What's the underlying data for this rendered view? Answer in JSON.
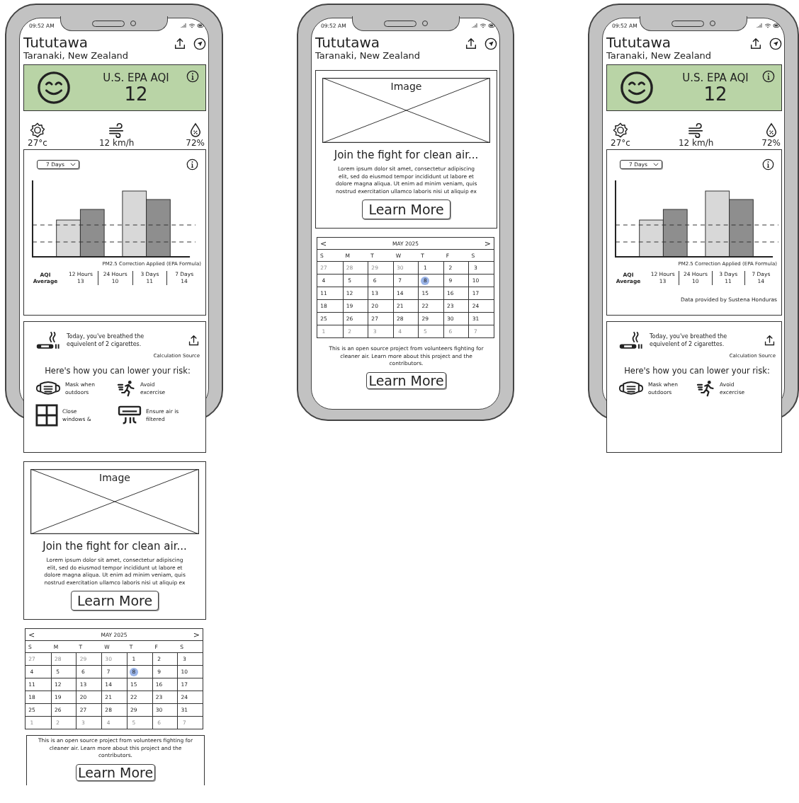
{
  "mockups": [
    {
      "status_time": "09:52 AM",
      "title": "Tututawa",
      "subtitle": "Taranaki, New Zealand",
      "sections": [
        {
          "kind": "aqi",
          "label": "U.S. EPA AQI",
          "value": "12"
        },
        {
          "kind": "weather",
          "items": [
            {
              "kind": "temperature",
              "text": "27°c"
            },
            {
              "kind": "wind",
              "text": "12 km/h"
            },
            {
              "kind": "humidity",
              "text": "72%"
            }
          ]
        },
        {
          "kind": "chart",
          "dropdown": "7 Days",
          "note": "PM2.5 Correction Applied (EPA Formula)",
          "average_label": "AQI Average",
          "averages": [
            {
              "label": "12 Hours",
              "value": "13"
            },
            {
              "label": "24 Hours",
              "value": "10"
            },
            {
              "label": "3 Days",
              "value": "11"
            },
            {
              "label": "7 Days",
              "value": "14"
            }
          ]
        },
        {
          "kind": "exposure",
          "text": "Today, you've breathed the equivelent of 2 cigarettes.",
          "source": "Calculation Source",
          "heading": "Here's how you can lower your risk:",
          "tips": [
            {
              "kind": "mask",
              "text": "Mask when outdoors"
            },
            {
              "kind": "exercise",
              "text": "Avoid excercise"
            },
            {
              "kind": "window",
              "text": "Close windows &"
            },
            {
              "kind": "filter",
              "text": "Ensure air is filtered"
            }
          ]
        },
        {
          "kind": "promo",
          "image_label": "Image",
          "heading": "Join the fight for clean air...",
          "body": "Lorem ipsum dolor sit amet, consectetur adipiscing elit, sed do eiusmod tempor incididunt ut labore et dolore magna aliqua. Ut enim ad minim veniam, quis nostrud exercitation ullamco laboris nisi ut aliquip ex",
          "button": "Learn More"
        },
        {
          "kind": "calendar",
          "month": "MAY 2025",
          "prev": "<",
          "next": ">",
          "weekdays": [
            "S",
            "M",
            "T",
            "W",
            "T",
            "F",
            "S"
          ],
          "weeks": [
            [
              {
                "day": "27",
                "outside": true,
                "selected": false
              },
              {
                "day": "28",
                "outside": true,
                "selected": false
              },
              {
                "day": "29",
                "outside": true,
                "selected": false
              },
              {
                "day": "30",
                "outside": true,
                "selected": false
              },
              {
                "day": "1",
                "outside": false,
                "selected": false
              },
              {
                "day": "2",
                "outside": false,
                "selected": false
              },
              {
                "day": "3",
                "outside": false,
                "selected": false
              }
            ],
            [
              {
                "day": "4",
                "outside": false,
                "selected": false
              },
              {
                "day": "5",
                "outside": false,
                "selected": false
              },
              {
                "day": "6",
                "outside": false,
                "selected": false
              },
              {
                "day": "7",
                "outside": false,
                "selected": false
              },
              {
                "day": "8",
                "outside": false,
                "selected": true
              },
              {
                "day": "9",
                "outside": false,
                "selected": false
              },
              {
                "day": "10",
                "outside": false,
                "selected": false
              }
            ],
            [
              {
                "day": "11",
                "outside": false,
                "selected": false
              },
              {
                "day": "12",
                "outside": false,
                "selected": false
              },
              {
                "day": "13",
                "outside": false,
                "selected": false
              },
              {
                "day": "14",
                "outside": false,
                "selected": false
              },
              {
                "day": "15",
                "outside": false,
                "selected": false
              },
              {
                "day": "16",
                "outside": false,
                "selected": false
              },
              {
                "day": "17",
                "outside": false,
                "selected": false
              }
            ],
            [
              {
                "day": "18",
                "outside": false,
                "selected": false
              },
              {
                "day": "19",
                "outside": false,
                "selected": false
              },
              {
                "day": "20",
                "outside": false,
                "selected": false
              },
              {
                "day": "21",
                "outside": false,
                "selected": false
              },
              {
                "day": "22",
                "outside": false,
                "selected": false
              },
              {
                "day": "23",
                "outside": false,
                "selected": false
              },
              {
                "day": "24",
                "outside": false,
                "selected": false
              }
            ],
            [
              {
                "day": "25",
                "outside": false,
                "selected": false
              },
              {
                "day": "26",
                "outside": false,
                "selected": false
              },
              {
                "day": "27",
                "outside": false,
                "selected": false
              },
              {
                "day": "28",
                "outside": false,
                "selected": false
              },
              {
                "day": "29",
                "outside": false,
                "selected": false
              },
              {
                "day": "30",
                "outside": false,
                "selected": false
              },
              {
                "day": "31",
                "outside": false,
                "selected": false
              }
            ],
            [
              {
                "day": "1",
                "outside": true,
                "selected": false
              },
              {
                "day": "2",
                "outside": true,
                "selected": false
              },
              {
                "day": "3",
                "outside": true,
                "selected": false
              },
              {
                "day": "4",
                "outside": true,
                "selected": false
              },
              {
                "day": "5",
                "outside": true,
                "selected": false
              },
              {
                "day": "6",
                "outside": true,
                "selected": false
              },
              {
                "day": "7",
                "outside": true,
                "selected": false
              }
            ]
          ]
        },
        {
          "kind": "about",
          "framed": true,
          "text": "This is an open source project from volunteers fighting for cleaner air. Learn more about this project and the contributors.",
          "button": "Learn More"
        }
      ]
    },
    {
      "status_time": "09:52 AM",
      "title": "Tututawa",
      "subtitle": "Taranaki, New Zealand",
      "sections": [
        {
          "kind": "promo",
          "image_label": "Image",
          "heading": "Join the fight for clean air...",
          "body": "Lorem ipsum dolor sit amet, consectetur adipiscing elit, sed do eiusmod tempor incididunt ut labore et dolore magna aliqua. Ut enim ad minim veniam, quis nostrud exercitation ullamco laboris nisi ut aliquip ex",
          "button": "Learn More"
        },
        {
          "kind": "calendar",
          "month": "MAY 2025",
          "prev": "<",
          "next": ">",
          "weekdays": [
            "S",
            "M",
            "T",
            "W",
            "T",
            "F",
            "S"
          ],
          "weeks": [
            [
              {
                "day": "27",
                "outside": true,
                "selected": false
              },
              {
                "day": "28",
                "outside": true,
                "selected": false
              },
              {
                "day": "29",
                "outside": true,
                "selected": false
              },
              {
                "day": "30",
                "outside": true,
                "selected": false
              },
              {
                "day": "1",
                "outside": false,
                "selected": false
              },
              {
                "day": "2",
                "outside": false,
                "selected": false
              },
              {
                "day": "3",
                "outside": false,
                "selected": false
              }
            ],
            [
              {
                "day": "4",
                "outside": false,
                "selected": false
              },
              {
                "day": "5",
                "outside": false,
                "selected": false
              },
              {
                "day": "6",
                "outside": false,
                "selected": false
              },
              {
                "day": "7",
                "outside": false,
                "selected": false
              },
              {
                "day": "8",
                "outside": false,
                "selected": true
              },
              {
                "day": "9",
                "outside": false,
                "selected": false
              },
              {
                "day": "10",
                "outside": false,
                "selected": false
              }
            ],
            [
              {
                "day": "11",
                "outside": false,
                "selected": false
              },
              {
                "day": "12",
                "outside": false,
                "selected": false
              },
              {
                "day": "13",
                "outside": false,
                "selected": false
              },
              {
                "day": "14",
                "outside": false,
                "selected": false
              },
              {
                "day": "15",
                "outside": false,
                "selected": false
              },
              {
                "day": "16",
                "outside": false,
                "selected": false
              },
              {
                "day": "17",
                "outside": false,
                "selected": false
              }
            ],
            [
              {
                "day": "18",
                "outside": false,
                "selected": false
              },
              {
                "day": "19",
                "outside": false,
                "selected": false
              },
              {
                "day": "20",
                "outside": false,
                "selected": false
              },
              {
                "day": "21",
                "outside": false,
                "selected": false
              },
              {
                "day": "22",
                "outside": false,
                "selected": false
              },
              {
                "day": "23",
                "outside": false,
                "selected": false
              },
              {
                "day": "24",
                "outside": false,
                "selected": false
              }
            ],
            [
              {
                "day": "25",
                "outside": false,
                "selected": false
              },
              {
                "day": "26",
                "outside": false,
                "selected": false
              },
              {
                "day": "27",
                "outside": false,
                "selected": false
              },
              {
                "day": "28",
                "outside": false,
                "selected": false
              },
              {
                "day": "29",
                "outside": false,
                "selected": false
              },
              {
                "day": "30",
                "outside": false,
                "selected": false
              },
              {
                "day": "31",
                "outside": false,
                "selected": false
              }
            ],
            [
              {
                "day": "1",
                "outside": true,
                "selected": false
              },
              {
                "day": "2",
                "outside": true,
                "selected": false
              },
              {
                "day": "3",
                "outside": true,
                "selected": false
              },
              {
                "day": "4",
                "outside": true,
                "selected": false
              },
              {
                "day": "5",
                "outside": true,
                "selected": false
              },
              {
                "day": "6",
                "outside": true,
                "selected": false
              },
              {
                "day": "7",
                "outside": true,
                "selected": false
              }
            ]
          ]
        },
        {
          "kind": "about",
          "framed": false,
          "text": "This is an open source project from volunteers fighting for cleaner air. Learn more about this project and the contributors.",
          "button": "Learn More"
        }
      ]
    },
    {
      "status_time": "09:52 AM",
      "title": "Tututawa",
      "subtitle": "Taranaki, New Zealand",
      "sections": [
        {
          "kind": "aqi",
          "label": "U.S. EPA AQI",
          "value": "12"
        },
        {
          "kind": "weather",
          "items": [
            {
              "kind": "temperature",
              "text": "27°c"
            },
            {
              "kind": "wind",
              "text": "12 km/h"
            },
            {
              "kind": "humidity",
              "text": "72%"
            }
          ]
        },
        {
          "kind": "chart",
          "dropdown": "7 Days",
          "note": "PM2.5 Correction Applied (EPA Formula)",
          "average_label": "AQI Average",
          "averages": [
            {
              "label": "12 Hours",
              "value": "13"
            },
            {
              "label": "24 Hours",
              "value": "10"
            },
            {
              "label": "3 Days",
              "value": "11"
            },
            {
              "label": "7 Days",
              "value": "14"
            }
          ],
          "footer": "Data provided by Sustena Honduras"
        },
        {
          "kind": "exposure",
          "text": "Today, you've breathed the equivelent of 2 cigarettes.",
          "source": "Calculation Source",
          "heading": "Here's how you can lower your risk:",
          "tips": [
            {
              "kind": "mask",
              "text": "Mask when outdoors"
            },
            {
              "kind": "exercise",
              "text": "Avoid excercise"
            }
          ]
        }
      ]
    }
  ]
}
